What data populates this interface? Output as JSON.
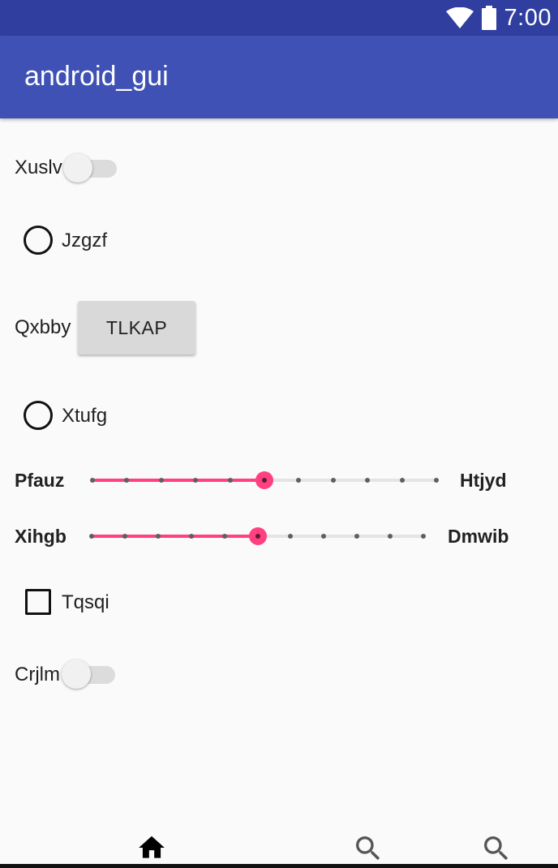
{
  "status_bar": {
    "time": "7:00",
    "icons": [
      "wifi-icon",
      "battery-icon"
    ]
  },
  "app_bar": {
    "title": "android_gui"
  },
  "form": {
    "switch_1": {
      "label": "Xuslv",
      "checked": false
    },
    "radio_1": {
      "label": "Jzgzf",
      "checked": false
    },
    "button_row": {
      "label": "Qxbby",
      "button_text": "TLKAP"
    },
    "radio_2": {
      "label": "Xtufg",
      "checked": false
    },
    "slider_1": {
      "left_label": "Pfauz",
      "right_label": "Htjyd",
      "value": 5,
      "max": 10
    },
    "slider_2": {
      "left_label": "Xihgb",
      "right_label": "Dmwib",
      "value": 5,
      "max": 10
    },
    "checkbox_1": {
      "label": "Tqsqi",
      "checked": false
    },
    "switch_2": {
      "label": "Crjlm",
      "checked": false
    }
  },
  "bottom_nav": {
    "items": [
      {
        "icon": "home-icon",
        "active": true
      },
      {
        "icon": "search-icon",
        "active": false
      },
      {
        "icon": "search-icon",
        "active": false
      }
    ]
  },
  "colors": {
    "status_bar": "#303f9f",
    "app_bar": "#3f51b5",
    "accent": "#ff4081",
    "background": "#fafafa"
  }
}
